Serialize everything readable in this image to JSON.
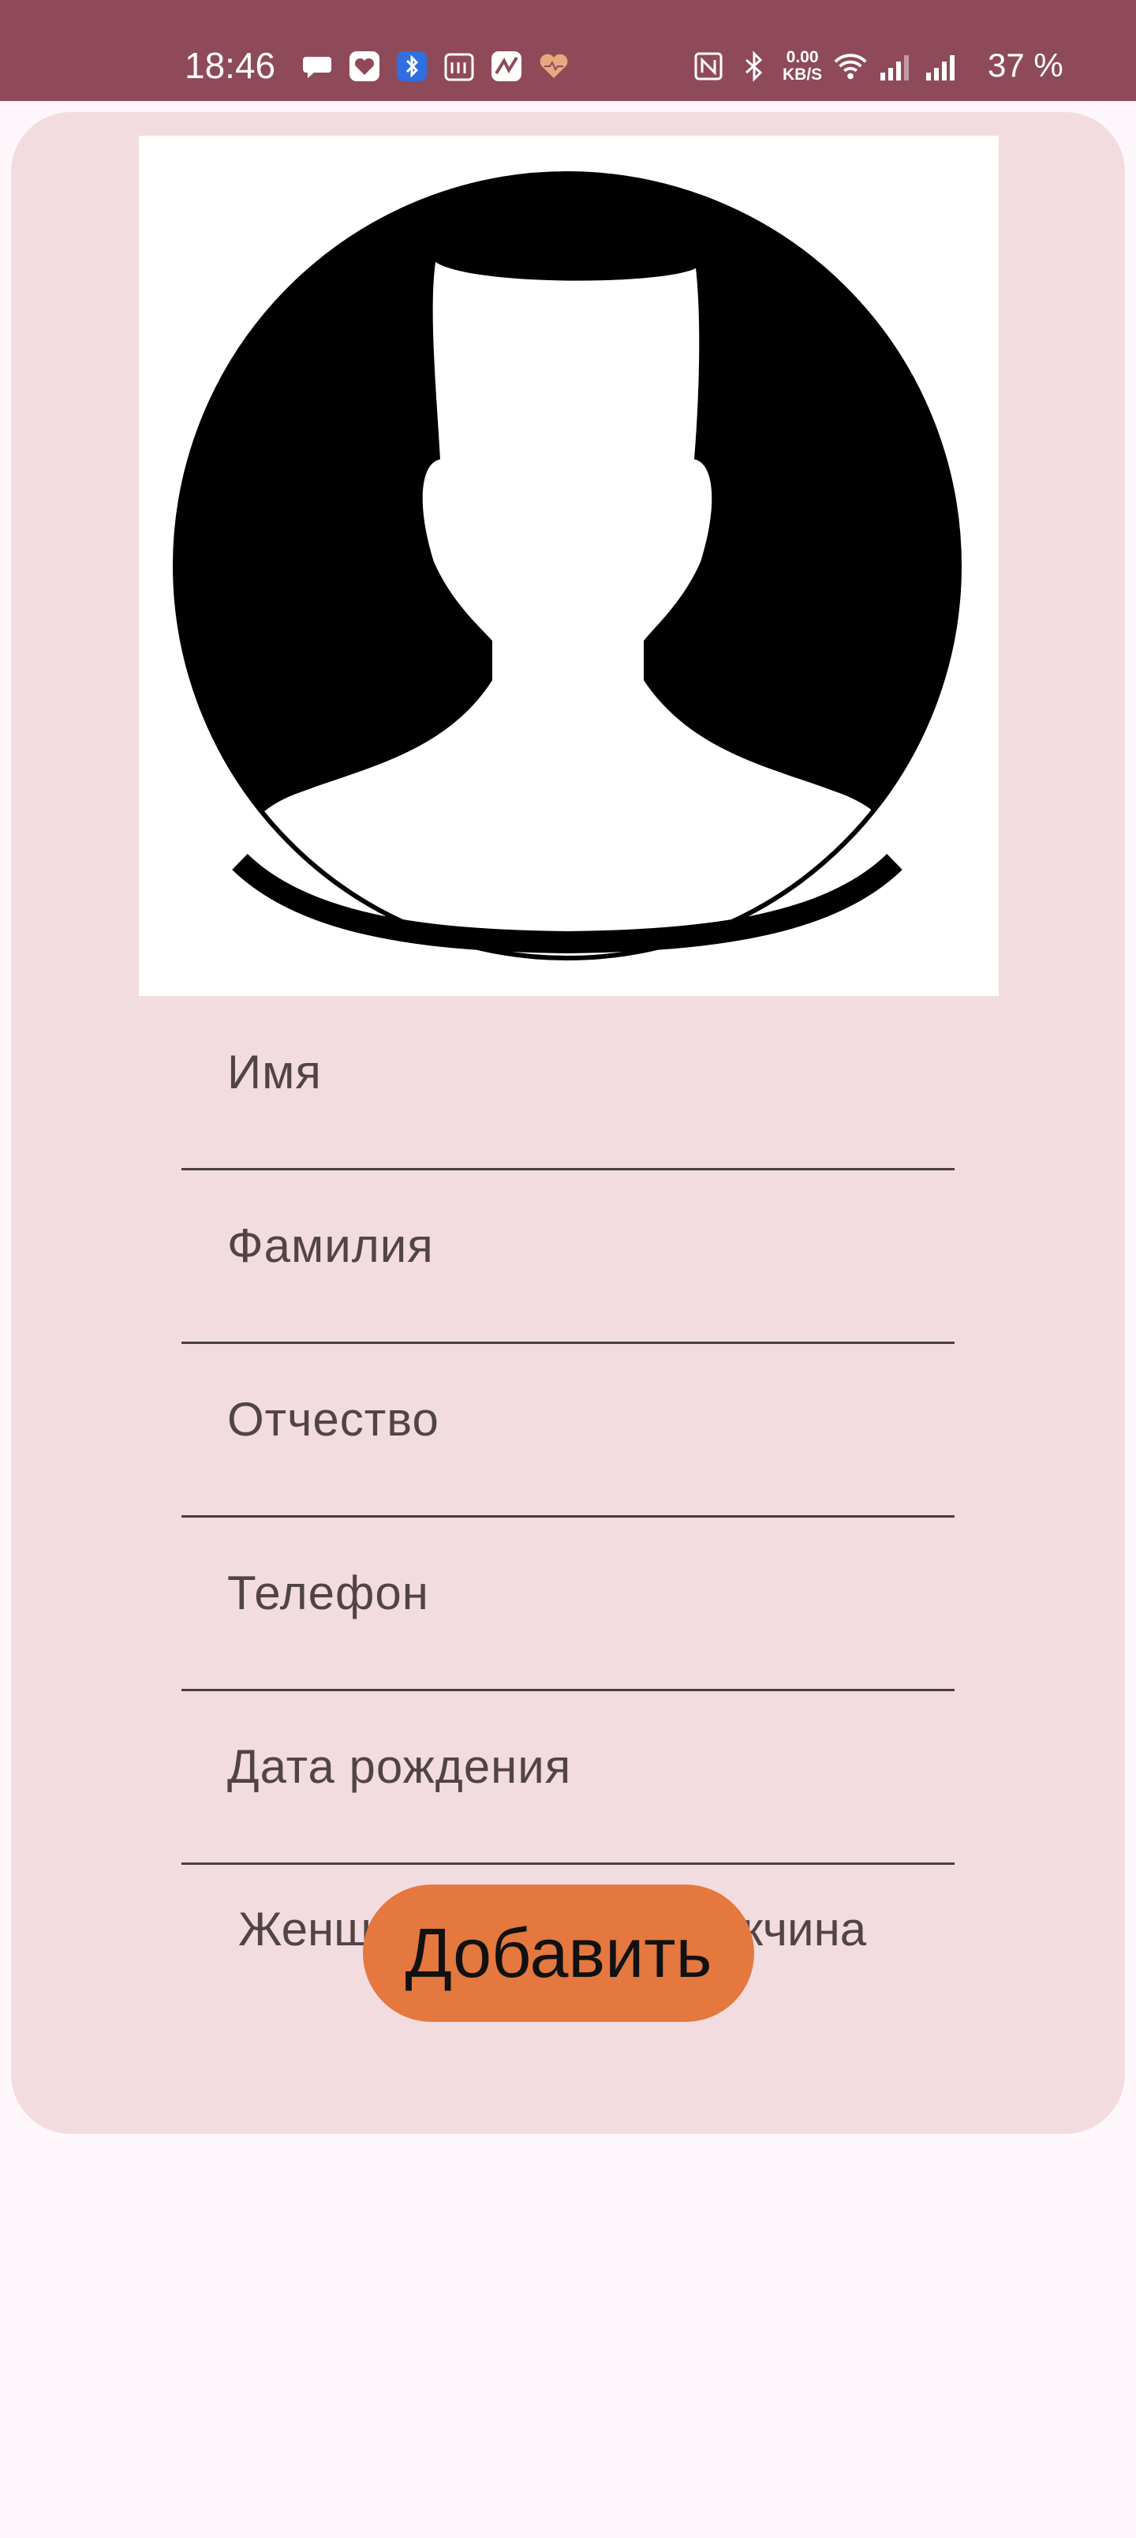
{
  "status_bar": {
    "time": "18:46",
    "network_speed_value": "0.00",
    "network_speed_unit": "KB/S",
    "battery": "37 %",
    "icons_left": [
      "chat-bubble-icon",
      "health-app-icon",
      "bluetooth-app-icon",
      "calendar-app-icon",
      "stocks-app-icon",
      "heart-rate-icon"
    ],
    "icons_right": [
      "nfc-icon",
      "bluetooth-icon",
      "wifi-icon",
      "signal-1-icon",
      "signal-2-icon"
    ]
  },
  "form": {
    "avatar": "person-silhouette-icon",
    "fields": {
      "first_name": "Имя",
      "last_name": "Фамилия",
      "patronymic": "Отчество",
      "phone": "Телефон",
      "birth_date": "Дата рождения"
    },
    "gender": {
      "female_label": "Женщина",
      "male_label": "Мужчина",
      "switch_on": true
    },
    "add_button": "Добавить"
  },
  "colors": {
    "status_bar": "#8f4a5a",
    "card": "#f2dcdf",
    "accent": "#e4783e",
    "background": "#fdf7fc"
  }
}
